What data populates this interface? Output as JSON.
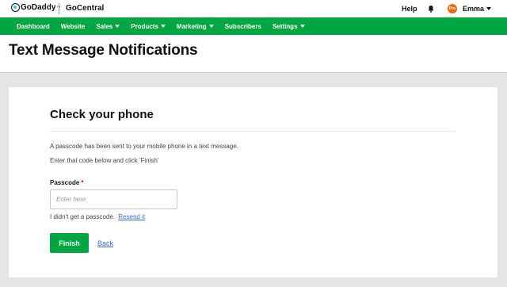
{
  "topbar": {
    "brand": "GoDaddy",
    "product": "GoCentral",
    "help_label": "Help",
    "avatar_initials": "Pro",
    "user_name": "Emma"
  },
  "nav": {
    "items": [
      {
        "label": "Dashboard",
        "has_dropdown": false
      },
      {
        "label": "Website",
        "has_dropdown": false
      },
      {
        "label": "Sales",
        "has_dropdown": true
      },
      {
        "label": "Products",
        "has_dropdown": true
      },
      {
        "label": "Marketing",
        "has_dropdown": true
      },
      {
        "label": "Subscribers",
        "has_dropdown": false
      },
      {
        "label": "Settings",
        "has_dropdown": true
      }
    ]
  },
  "page": {
    "title": "Text Message Notifications"
  },
  "card": {
    "title": "Check your phone",
    "message_1": "A passcode has been sent to your mobile phone in a text message.",
    "message_2": "Enter that code below and click 'Finish'",
    "passcode_label": "Passcode",
    "required_mark": "*",
    "passcode_placeholder": "Enter here",
    "passcode_value": "",
    "no_passcode_text": "I didn't get a passcode.",
    "resend_label": "Resend it",
    "finish_label": "Finish",
    "back_label": "Back"
  },
  "colors": {
    "brand_green": "#00a63f",
    "link_blue": "#3a68d6",
    "avatar_orange": "#ef6c00",
    "required_red": "#dd0000"
  }
}
